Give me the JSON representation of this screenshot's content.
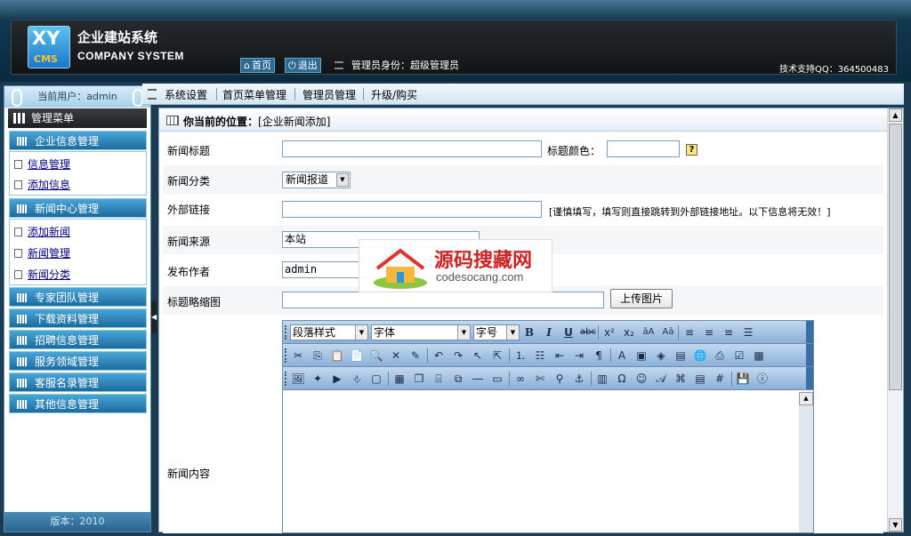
{
  "header": {
    "logo_xy": "XY",
    "logo_cms": "CMS",
    "title_cn": "企业建站系统",
    "title_en": "COMPANY SYSTEM",
    "home_label": "首页",
    "logout_label": "退出",
    "role_text": "管理员身份：超级管理员",
    "support_text": "技术支持QQ：364500483"
  },
  "sidebar": {
    "current_user": "当前用户：admin",
    "menu_title": "管理菜单",
    "groups": [
      {
        "label": "企业信息管理",
        "items": [
          "信息管理",
          "添加信息"
        ]
      },
      {
        "label": "新闻中心管理",
        "items": [
          "添加新闻",
          "新闻管理",
          "新闻分类"
        ]
      },
      {
        "label": "专家团队管理"
      },
      {
        "label": "下载资料管理"
      },
      {
        "label": "招聘信息管理"
      },
      {
        "label": "服务领域管理"
      },
      {
        "label": "客服名录管理"
      },
      {
        "label": "其他信息管理"
      }
    ],
    "version": "版本：2010"
  },
  "topnav": {
    "items": [
      "系统设置",
      "首页菜单管理",
      "管理员管理",
      "升级/购买"
    ]
  },
  "location": {
    "prefix": "你当前的位置：",
    "path": "[企业新闻添加]"
  },
  "form": {
    "title_label": "新闻标题",
    "title_value": "",
    "color_label": "标题颜色：",
    "color_value": "",
    "help_label": "?",
    "category_label": "新闻分类",
    "category_value": "新闻报道",
    "link_label": "外部链接",
    "link_value": "",
    "link_note": "[谨慎填写，填写则直接跳转到外部链接地址。以下信息将无效！]",
    "source_label": "新闻来源",
    "source_value": "本站",
    "author_label": "发布作者",
    "author_value": "admin",
    "thumb_label": "标题略缩图",
    "thumb_value": "",
    "upload_label": "上传图片",
    "content_label": "新闻内容"
  },
  "editor": {
    "paragraph_style": "段落样式",
    "font": "字体",
    "font_size": "字号"
  },
  "watermark": {
    "text_cn": "源码搜藏网",
    "text_en": "codesocang.com"
  },
  "colors": {
    "header_bg": "#10384f",
    "menu_group": "#1a6c9e",
    "link": "#000080"
  }
}
